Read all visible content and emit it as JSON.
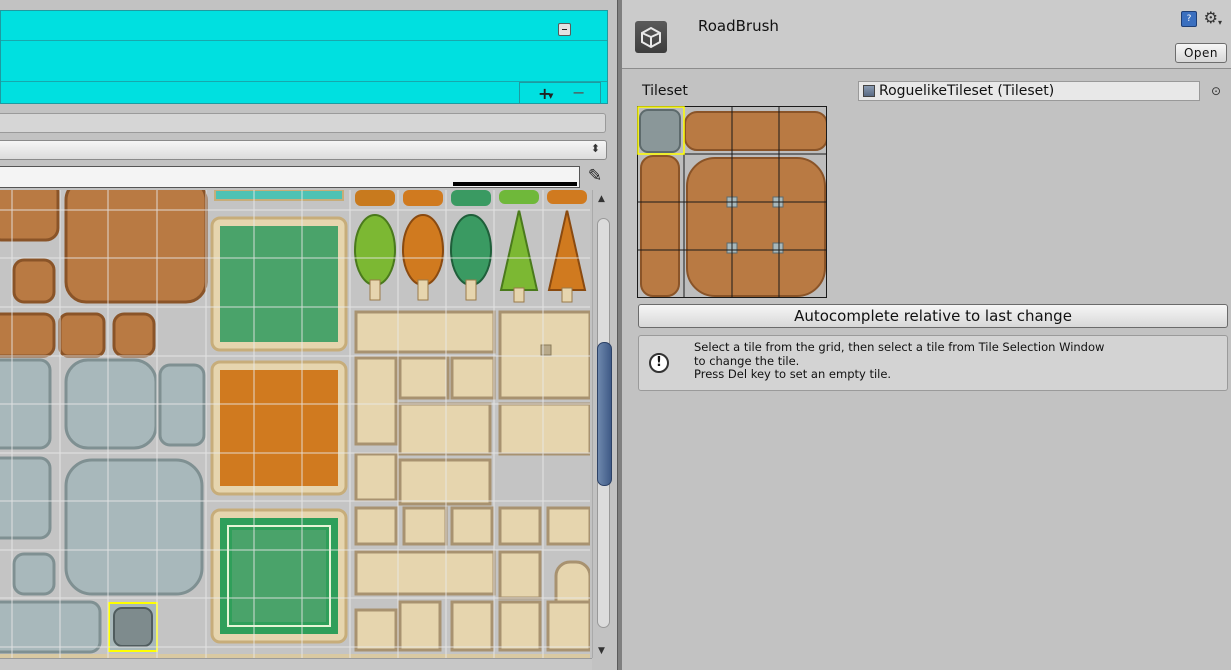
{
  "inspector": {
    "asset_name": "RoadBrush",
    "open_label": "Open",
    "tileset_label": "Tileset",
    "tileset_value": "RoguelikeTileset (Tileset)",
    "autocomplete_label": "Autocomplete relative to last change",
    "help_lines": [
      "Select  a tile from the grid, then select a tile from Tile Selection Window",
      "to change the tile.",
      "Press Del key to set an empty tile."
    ]
  },
  "icons": {
    "unity_logo": "unity-icon",
    "help": "help-book-icon",
    "settings": "gear-icon",
    "picker": "object-picker-icon",
    "eyedropper": "eyedropper-icon",
    "info": "info-icon"
  },
  "left_panel": {
    "list_add": "+",
    "list_remove": "−"
  },
  "colors": {
    "cyan_panel": "#00e0e0",
    "selection_highlight": "#ffff00",
    "scroll_thumb": "#4a6590",
    "dirt": "#b97a43",
    "stone": "#a8b8bb",
    "grass": "#4aa36a",
    "orange": "#d07a1f",
    "sand": "#e6d5ae"
  }
}
